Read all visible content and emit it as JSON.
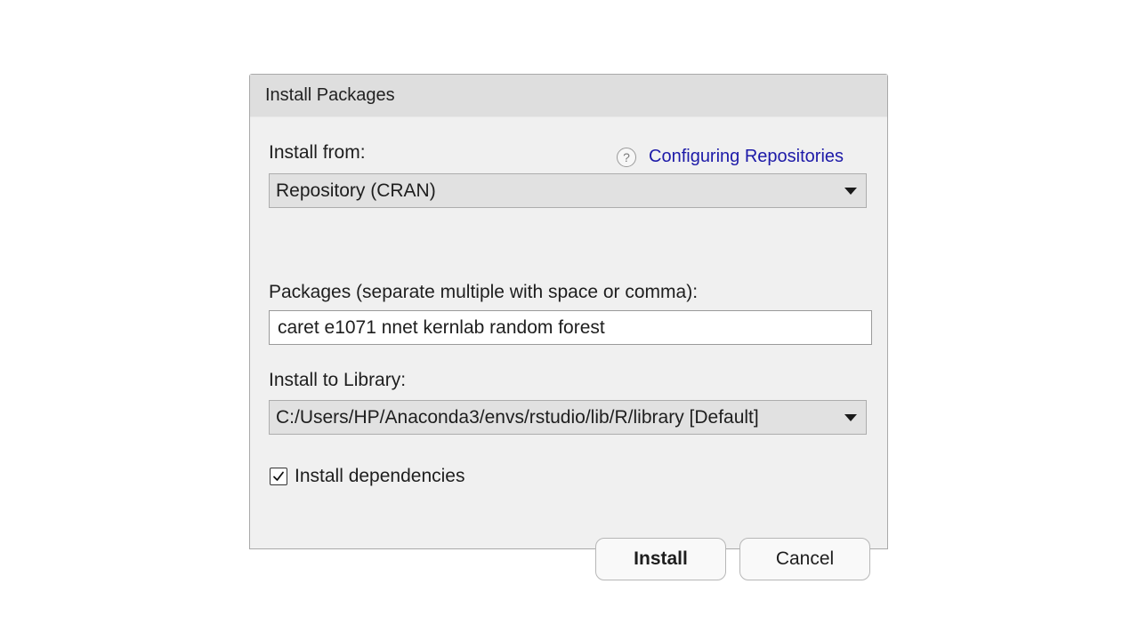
{
  "dialog": {
    "title": "Install Packages"
  },
  "install_from": {
    "label": "Install from:",
    "help_icon": "question-circle-icon",
    "help_link": "Configuring Repositories",
    "selected": "Repository (CRAN)"
  },
  "packages": {
    "label": "Packages (separate multiple with space or comma):",
    "value": "caret e1071 nnet kernlab random forest"
  },
  "library": {
    "label": "Install to Library:",
    "selected": "C:/Users/HP/Anaconda3/envs/rstudio/lib/R/library [Default]"
  },
  "dependencies": {
    "label": "Install dependencies",
    "checked": true
  },
  "buttons": {
    "install": "Install",
    "cancel": "Cancel"
  },
  "colors": {
    "link": "#1d1aa8",
    "titlebar": "#dedede",
    "dialog_bg": "#f0f0f0",
    "select_bg": "#e1e1e1"
  }
}
